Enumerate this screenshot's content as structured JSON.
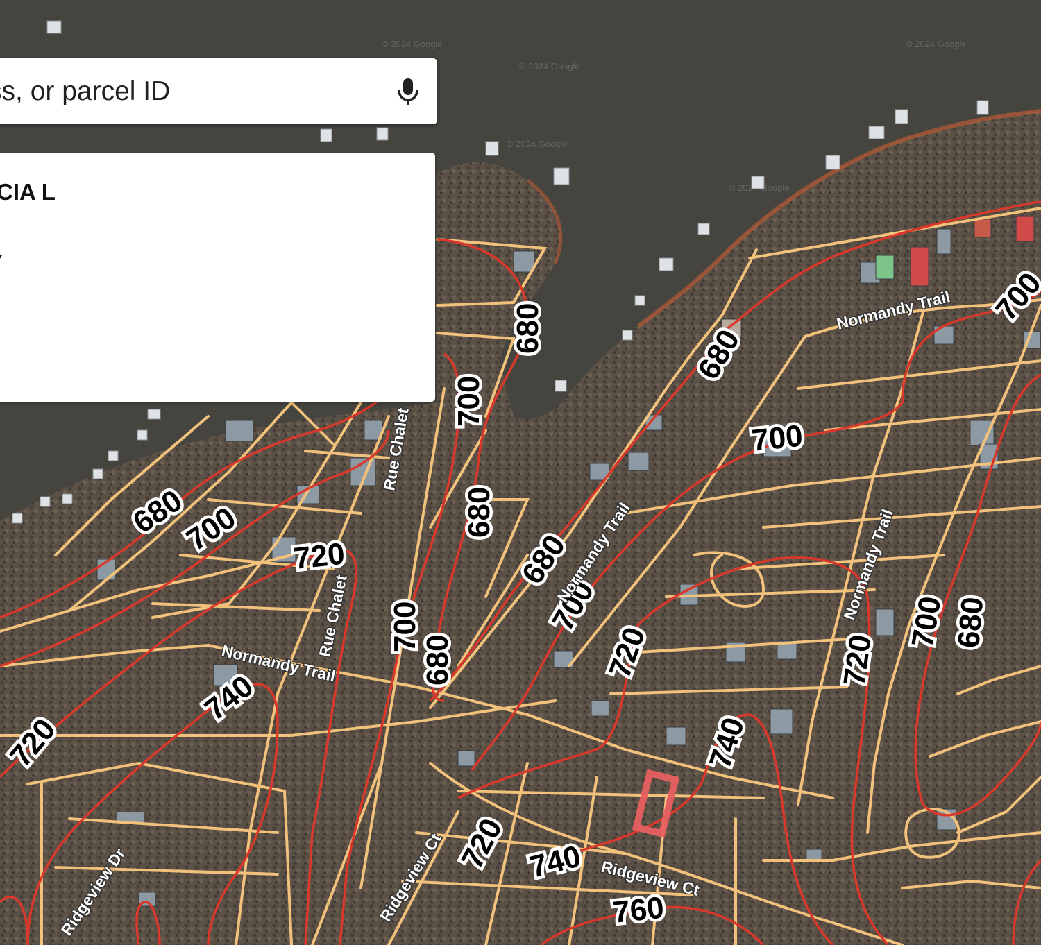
{
  "search": {
    "placeholder": "ldress, or parcel ID",
    "mic_icon": "microphone-icon"
  },
  "result_panel": {
    "owner_line": "RICIA L",
    "line2": "Y"
  },
  "map": {
    "watermark": "© 2024 Google",
    "contour_labels": [
      "680",
      "700",
      "720",
      "740",
      "760"
    ],
    "streets": {
      "normandy_trail": "Normandy Trail",
      "rue_chalet": "Rue Chalet",
      "ridgeview_ct": "Ridgeview Ct",
      "ridgeview_dr": "Ridgeview Dr"
    },
    "colors": {
      "water": "#46443f",
      "land": "#5b5248",
      "parcel_lines": "#f2c27c",
      "contour_lines": "#d9382b",
      "selected_parcel": "#e86060",
      "shore": "#c0603a"
    }
  }
}
